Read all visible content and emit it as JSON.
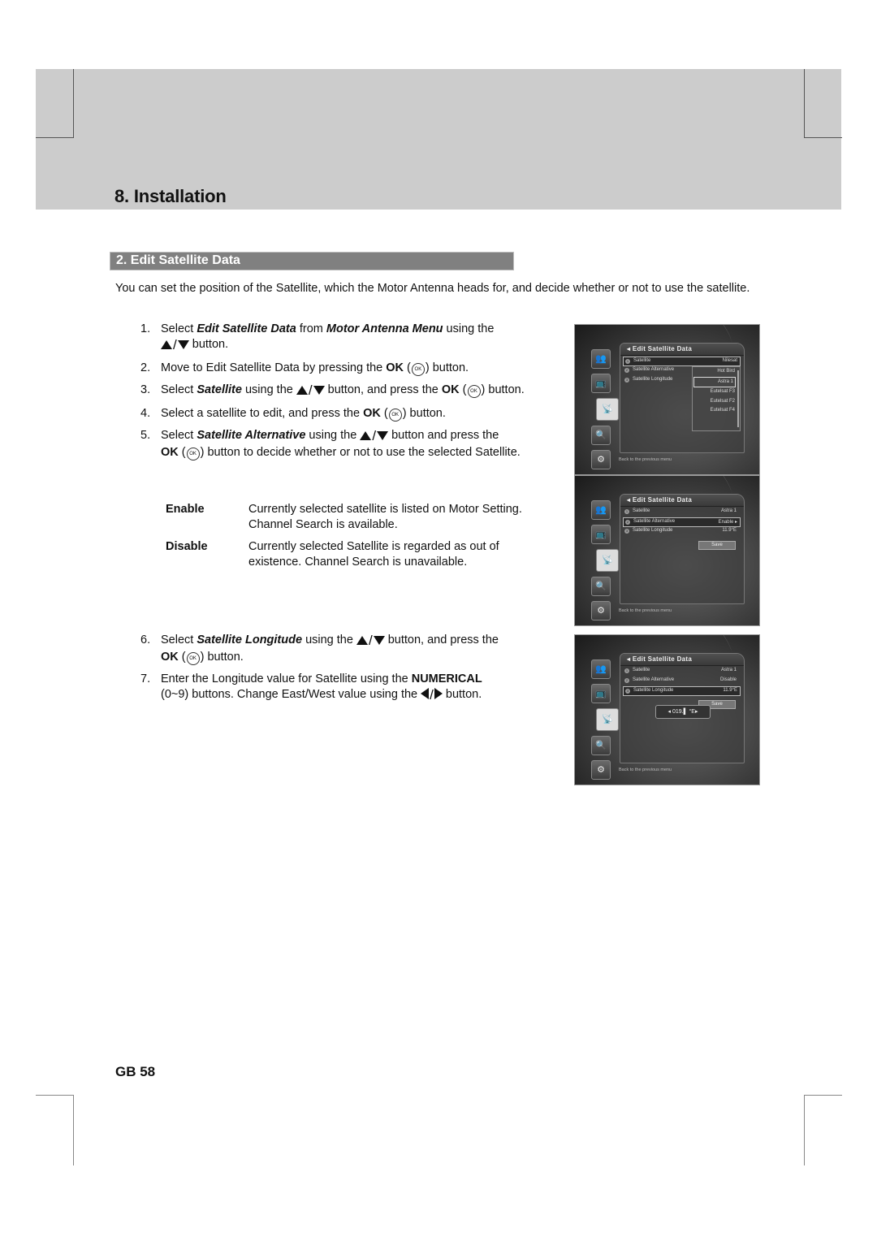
{
  "chapter": {
    "title": "8. Installation"
  },
  "section": {
    "title": "2. Edit Satellite Data"
  },
  "intro": "You can set the position of the Satellite, which the Motor Antenna heads for, and decide whether or not to use the satellite.",
  "icons": {
    "ok": "OK",
    "up_down": "up-down-arrow-buttons",
    "left_right": "left-right-arrow-buttons"
  },
  "steps": [
    {
      "num": "1.",
      "t1": "Select ",
      "b1": "Edit Satellite Data",
      "t2": " from ",
      "b2": "Motor Antenna Menu",
      "t3": " using the",
      "t4": " button."
    },
    {
      "num": "2.",
      "t1": "Move to Edit Satellite Data by pressing the ",
      "ok": "OK",
      "t2": " button."
    },
    {
      "num": "3.",
      "t1": "Select ",
      "b1": "Satellite",
      "t2": " using the ",
      "t3": " button, and press the ",
      "ok": "OK",
      "t4": " button."
    },
    {
      "num": "4.",
      "t1": "Select a satellite to edit, and press the ",
      "ok": "OK",
      "t2": " button."
    },
    {
      "num": "5.",
      "t1": "Select ",
      "b1": "Satellite Alternative",
      "t2": " using the ",
      "t3": " button and press the ",
      "ok": "OK",
      "t4": " button to decide whether or not to use the selected Satellite."
    },
    {
      "num": "6.",
      "t1": "Select ",
      "b1": "Satellite Longitude",
      "t2": " using the ",
      "t3": " button, and press the ",
      "ok": "OK",
      "t4": " button."
    },
    {
      "num": "7.",
      "t1": "Enter the Longitude value for Satellite using the ",
      "b1": "NUMERICAL",
      "t2": " (0~9) buttons. Change East/West value using the ",
      "t3": " button."
    }
  ],
  "definitions": [
    {
      "term": "Enable",
      "desc": "Currently selected satellite is listed on Motor Setting. Channel Search is available."
    },
    {
      "term": "Disable",
      "desc": "Currently selected Satellite is regarded as out of existence. Channel Search is unavailable."
    }
  ],
  "page_number": "GB 58",
  "screens": [
    {
      "title": "Edit Satellite Data",
      "rows": [
        {
          "n": "1",
          "label": "Satellite",
          "value": "Nilesat"
        },
        {
          "n": "2",
          "label": "Satellite Alternative",
          "value": ""
        },
        {
          "n": "3",
          "label": "Satellite Longitude",
          "value": ""
        }
      ],
      "dropdown": [
        "Hot Bird",
        "Astra 1",
        "Eutelsat F3",
        "Eutelsat F2",
        "Eutelsat F4"
      ],
      "footer": "Back to the previous menu"
    },
    {
      "title": "Edit Satellite Data",
      "rows": [
        {
          "n": "1",
          "label": "Satellite",
          "value": "Astra 1"
        },
        {
          "n": "2",
          "label": "Satellite Alternative",
          "value": "Enable ▸"
        },
        {
          "n": "3",
          "label": "Satellite Longitude",
          "value": "11.9°E"
        }
      ],
      "save": "Save",
      "footer": "Back to the previous menu"
    },
    {
      "title": "Edit Satellite Data",
      "rows": [
        {
          "n": "1",
          "label": "Satellite",
          "value": "Astra 1"
        },
        {
          "n": "2",
          "label": "Satellite Alternative",
          "value": "Disable"
        },
        {
          "n": "3",
          "label": "Satellite Longitude",
          "value": "11.9°E"
        }
      ],
      "save": "Save",
      "longitude_input": "◂  019.▌  °E▸",
      "footer": "Back to the previous menu"
    }
  ]
}
